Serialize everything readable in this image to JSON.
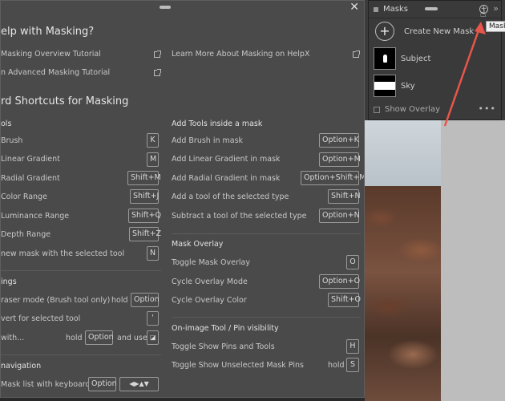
{
  "masks": {
    "title": "Masks",
    "create_label": "Create New Mask",
    "items": [
      {
        "label": "Subject"
      },
      {
        "label": "Sky"
      }
    ],
    "show_overlay": "Show Overlay",
    "more": "•••",
    "tooltip": "Mask"
  },
  "help": {
    "title": "elp with Masking?",
    "links": [
      "Masking Overview Tutorial",
      "n Advanced Masking Tutorial",
      "Learn More About Masking on HelpX"
    ],
    "shortcuts_title": "rd Shortcuts for Masking",
    "left": {
      "tools_header": "ols",
      "tools": [
        {
          "label": "Brush",
          "key": "K"
        },
        {
          "label": "Linear Gradient",
          "key": "M"
        },
        {
          "label": "Radial Gradient",
          "key": "Shift+M"
        },
        {
          "label": "Color Range",
          "key": "Shift+J"
        },
        {
          "label": "Luminance Range",
          "key": "Shift+Q"
        },
        {
          "label": "Depth Range",
          "key": "Shift+Z"
        },
        {
          "label": "new mask with the selected tool",
          "key": "N"
        }
      ],
      "settings_header": "ings",
      "eraser": {
        "label": "raser mode (Brush tool only)",
        "hold": "hold",
        "key": "Option"
      },
      "invert": {
        "label": "vert for selected tool",
        "key": "'"
      },
      "with_row": {
        "label": "with...",
        "hold": "hold",
        "key": "Option",
        "and_use": "and use",
        "key2": "◪"
      },
      "nav_header": "navigation",
      "nav": {
        "label": "Mask list with keyboard",
        "key": "Option",
        "key2": "◀▶▲▼"
      }
    },
    "right": {
      "add_header": "Add Tools inside a mask",
      "add": [
        {
          "label": "Add Brush in mask",
          "key": "Option+K"
        },
        {
          "label": "Add Linear Gradient in mask",
          "key": "Option+M"
        },
        {
          "label": "Add Radial Gradient in mask",
          "key": "Option+Shift+M"
        },
        {
          "label": "Add a tool of the selected type",
          "key": "Shift+N"
        },
        {
          "label": "Subtract a tool of the selected type",
          "key": "Option+N"
        }
      ],
      "overlay_header": "Mask Overlay",
      "overlay": [
        {
          "label": "Toggle Mask Overlay",
          "key": "O"
        },
        {
          "label": "Cycle Overlay Mode",
          "key": "Option+O"
        },
        {
          "label": "Cycle Overlay Color",
          "key": "Shift+O"
        }
      ],
      "pins_header": "On-image Tool / Pin visibility",
      "pins": [
        {
          "label": "Toggle Show Pins and Tools",
          "key": "H"
        },
        {
          "label": "Toggle Show Unselected Mask Pins",
          "hold": "hold",
          "key": "S"
        }
      ]
    },
    "close": "✕"
  },
  "colors": {
    "panel": "#4a4a4a",
    "arrow": "#e8554a"
  }
}
